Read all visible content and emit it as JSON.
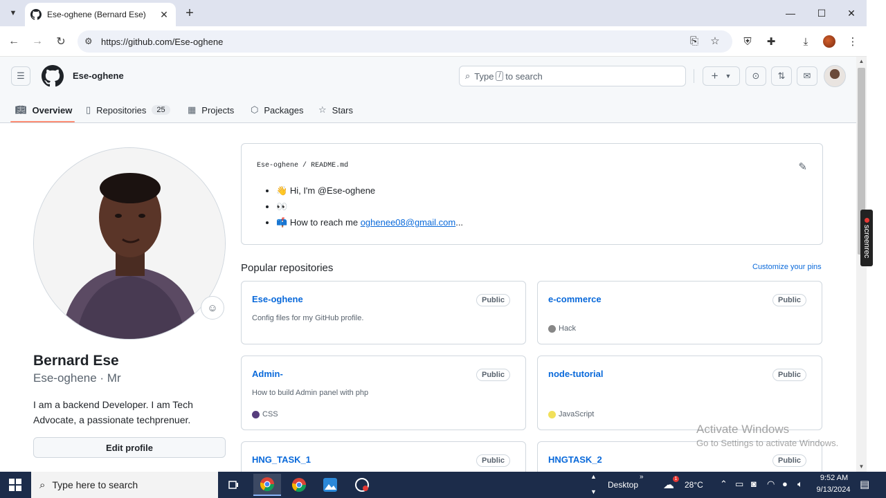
{
  "browser": {
    "tab_title": "Ese-oghene (Bernard Ese)",
    "tab_close": "✕",
    "new_tab": "+",
    "url": "https://github.com/Ese-oghene"
  },
  "github": {
    "header_username": "Ese-oghene",
    "search_prefix": "Type",
    "search_key": "/",
    "search_suffix": "to search",
    "tabs": [
      {
        "label": "Overview",
        "icon": "book-icon"
      },
      {
        "label": "Repositories",
        "icon": "repo-icon",
        "count": "25"
      },
      {
        "label": "Projects",
        "icon": "table-icon"
      },
      {
        "label": "Packages",
        "icon": "package-icon"
      },
      {
        "label": "Stars",
        "icon": "star-icon"
      }
    ]
  },
  "profile": {
    "name": "Bernard Ese",
    "login": "Ese-oghene · Mr",
    "bio": "I am a backend Developer. I am Tech Advocate, a passionate techprenuer.",
    "edit_button": "Edit profile"
  },
  "readme": {
    "owner": "Ese-oghene",
    "separator": "/",
    "file": "README.md",
    "items": [
      {
        "emoji": "👋",
        "text": "Hi, I'm @Ese-oghene"
      },
      {
        "emoji": "👀",
        "text": ""
      },
      {
        "emoji": "📫",
        "text": "How to reach me ",
        "link": "oghenee08@gmail.com",
        "after": "..."
      }
    ]
  },
  "popular": {
    "title": "Popular repositories",
    "customize": "Customize your pins",
    "repos": [
      {
        "name": "Ese-oghene",
        "visibility": "Public",
        "description": "Config files for my GitHub profile.",
        "language": "",
        "lang_color": ""
      },
      {
        "name": "e-commerce",
        "visibility": "Public",
        "description": "",
        "language": "Hack",
        "lang_color": "#878787"
      },
      {
        "name": "Admin-",
        "visibility": "Public",
        "description": "How to build Admin panel with php",
        "language": "CSS",
        "lang_color": "#563d7c"
      },
      {
        "name": "node-tutorial",
        "visibility": "Public",
        "description": "",
        "language": "JavaScript",
        "lang_color": "#f1e05a"
      },
      {
        "name": "HNG_TASK_1",
        "visibility": "Public",
        "description": "",
        "language": "",
        "lang_color": ""
      },
      {
        "name": "HNGTASK_2",
        "visibility": "Public",
        "description": "",
        "language": "",
        "lang_color": ""
      }
    ]
  },
  "watermark": {
    "line1": "Activate Windows",
    "line2": "Go to Settings to activate Windows."
  },
  "screenrec": "screenrec",
  "taskbar": {
    "search_placeholder": "Type here to search",
    "desktop": "Desktop",
    "weather": "28°C",
    "time": "9:52 AM",
    "date": "9/13/2024",
    "notif_badge": "1"
  }
}
